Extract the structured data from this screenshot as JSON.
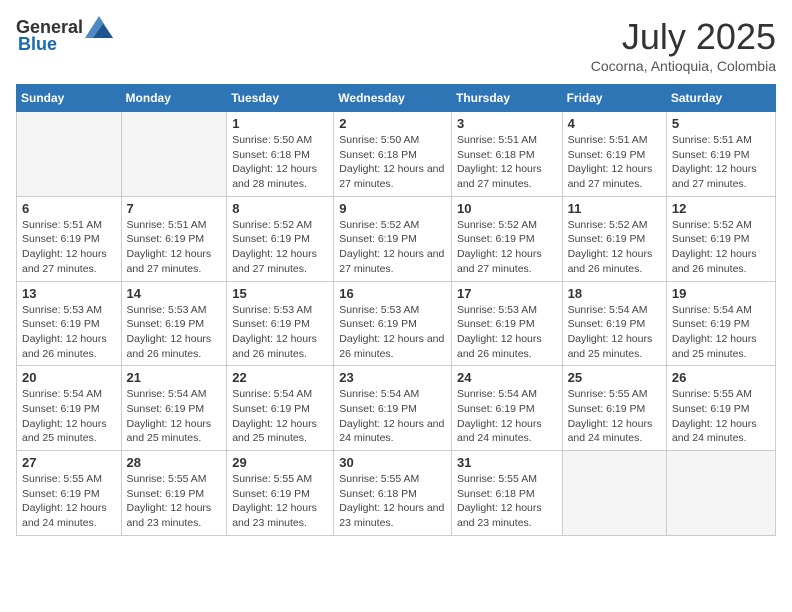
{
  "header": {
    "logo_general": "General",
    "logo_blue": "Blue",
    "month_year": "July 2025",
    "location": "Cocorna, Antioquia, Colombia"
  },
  "days_of_week": [
    "Sunday",
    "Monday",
    "Tuesday",
    "Wednesday",
    "Thursday",
    "Friday",
    "Saturday"
  ],
  "weeks": [
    [
      {
        "day": "",
        "empty": true
      },
      {
        "day": "",
        "empty": true
      },
      {
        "day": "1",
        "sunrise": "Sunrise: 5:50 AM",
        "sunset": "Sunset: 6:18 PM",
        "daylight": "Daylight: 12 hours and 28 minutes."
      },
      {
        "day": "2",
        "sunrise": "Sunrise: 5:50 AM",
        "sunset": "Sunset: 6:18 PM",
        "daylight": "Daylight: 12 hours and 27 minutes."
      },
      {
        "day": "3",
        "sunrise": "Sunrise: 5:51 AM",
        "sunset": "Sunset: 6:18 PM",
        "daylight": "Daylight: 12 hours and 27 minutes."
      },
      {
        "day": "4",
        "sunrise": "Sunrise: 5:51 AM",
        "sunset": "Sunset: 6:19 PM",
        "daylight": "Daylight: 12 hours and 27 minutes."
      },
      {
        "day": "5",
        "sunrise": "Sunrise: 5:51 AM",
        "sunset": "Sunset: 6:19 PM",
        "daylight": "Daylight: 12 hours and 27 minutes."
      }
    ],
    [
      {
        "day": "6",
        "sunrise": "Sunrise: 5:51 AM",
        "sunset": "Sunset: 6:19 PM",
        "daylight": "Daylight: 12 hours and 27 minutes."
      },
      {
        "day": "7",
        "sunrise": "Sunrise: 5:51 AM",
        "sunset": "Sunset: 6:19 PM",
        "daylight": "Daylight: 12 hours and 27 minutes."
      },
      {
        "day": "8",
        "sunrise": "Sunrise: 5:52 AM",
        "sunset": "Sunset: 6:19 PM",
        "daylight": "Daylight: 12 hours and 27 minutes."
      },
      {
        "day": "9",
        "sunrise": "Sunrise: 5:52 AM",
        "sunset": "Sunset: 6:19 PM",
        "daylight": "Daylight: 12 hours and 27 minutes."
      },
      {
        "day": "10",
        "sunrise": "Sunrise: 5:52 AM",
        "sunset": "Sunset: 6:19 PM",
        "daylight": "Daylight: 12 hours and 27 minutes."
      },
      {
        "day": "11",
        "sunrise": "Sunrise: 5:52 AM",
        "sunset": "Sunset: 6:19 PM",
        "daylight": "Daylight: 12 hours and 26 minutes."
      },
      {
        "day": "12",
        "sunrise": "Sunrise: 5:52 AM",
        "sunset": "Sunset: 6:19 PM",
        "daylight": "Daylight: 12 hours and 26 minutes."
      }
    ],
    [
      {
        "day": "13",
        "sunrise": "Sunrise: 5:53 AM",
        "sunset": "Sunset: 6:19 PM",
        "daylight": "Daylight: 12 hours and 26 minutes."
      },
      {
        "day": "14",
        "sunrise": "Sunrise: 5:53 AM",
        "sunset": "Sunset: 6:19 PM",
        "daylight": "Daylight: 12 hours and 26 minutes."
      },
      {
        "day": "15",
        "sunrise": "Sunrise: 5:53 AM",
        "sunset": "Sunset: 6:19 PM",
        "daylight": "Daylight: 12 hours and 26 minutes."
      },
      {
        "day": "16",
        "sunrise": "Sunrise: 5:53 AM",
        "sunset": "Sunset: 6:19 PM",
        "daylight": "Daylight: 12 hours and 26 minutes."
      },
      {
        "day": "17",
        "sunrise": "Sunrise: 5:53 AM",
        "sunset": "Sunset: 6:19 PM",
        "daylight": "Daylight: 12 hours and 26 minutes."
      },
      {
        "day": "18",
        "sunrise": "Sunrise: 5:54 AM",
        "sunset": "Sunset: 6:19 PM",
        "daylight": "Daylight: 12 hours and 25 minutes."
      },
      {
        "day": "19",
        "sunrise": "Sunrise: 5:54 AM",
        "sunset": "Sunset: 6:19 PM",
        "daylight": "Daylight: 12 hours and 25 minutes."
      }
    ],
    [
      {
        "day": "20",
        "sunrise": "Sunrise: 5:54 AM",
        "sunset": "Sunset: 6:19 PM",
        "daylight": "Daylight: 12 hours and 25 minutes."
      },
      {
        "day": "21",
        "sunrise": "Sunrise: 5:54 AM",
        "sunset": "Sunset: 6:19 PM",
        "daylight": "Daylight: 12 hours and 25 minutes."
      },
      {
        "day": "22",
        "sunrise": "Sunrise: 5:54 AM",
        "sunset": "Sunset: 6:19 PM",
        "daylight": "Daylight: 12 hours and 25 minutes."
      },
      {
        "day": "23",
        "sunrise": "Sunrise: 5:54 AM",
        "sunset": "Sunset: 6:19 PM",
        "daylight": "Daylight: 12 hours and 24 minutes."
      },
      {
        "day": "24",
        "sunrise": "Sunrise: 5:54 AM",
        "sunset": "Sunset: 6:19 PM",
        "daylight": "Daylight: 12 hours and 24 minutes."
      },
      {
        "day": "25",
        "sunrise": "Sunrise: 5:55 AM",
        "sunset": "Sunset: 6:19 PM",
        "daylight": "Daylight: 12 hours and 24 minutes."
      },
      {
        "day": "26",
        "sunrise": "Sunrise: 5:55 AM",
        "sunset": "Sunset: 6:19 PM",
        "daylight": "Daylight: 12 hours and 24 minutes."
      }
    ],
    [
      {
        "day": "27",
        "sunrise": "Sunrise: 5:55 AM",
        "sunset": "Sunset: 6:19 PM",
        "daylight": "Daylight: 12 hours and 24 minutes."
      },
      {
        "day": "28",
        "sunrise": "Sunrise: 5:55 AM",
        "sunset": "Sunset: 6:19 PM",
        "daylight": "Daylight: 12 hours and 23 minutes."
      },
      {
        "day": "29",
        "sunrise": "Sunrise: 5:55 AM",
        "sunset": "Sunset: 6:19 PM",
        "daylight": "Daylight: 12 hours and 23 minutes."
      },
      {
        "day": "30",
        "sunrise": "Sunrise: 5:55 AM",
        "sunset": "Sunset: 6:18 PM",
        "daylight": "Daylight: 12 hours and 23 minutes."
      },
      {
        "day": "31",
        "sunrise": "Sunrise: 5:55 AM",
        "sunset": "Sunset: 6:18 PM",
        "daylight": "Daylight: 12 hours and 23 minutes."
      },
      {
        "day": "",
        "empty": true
      },
      {
        "day": "",
        "empty": true
      }
    ]
  ]
}
